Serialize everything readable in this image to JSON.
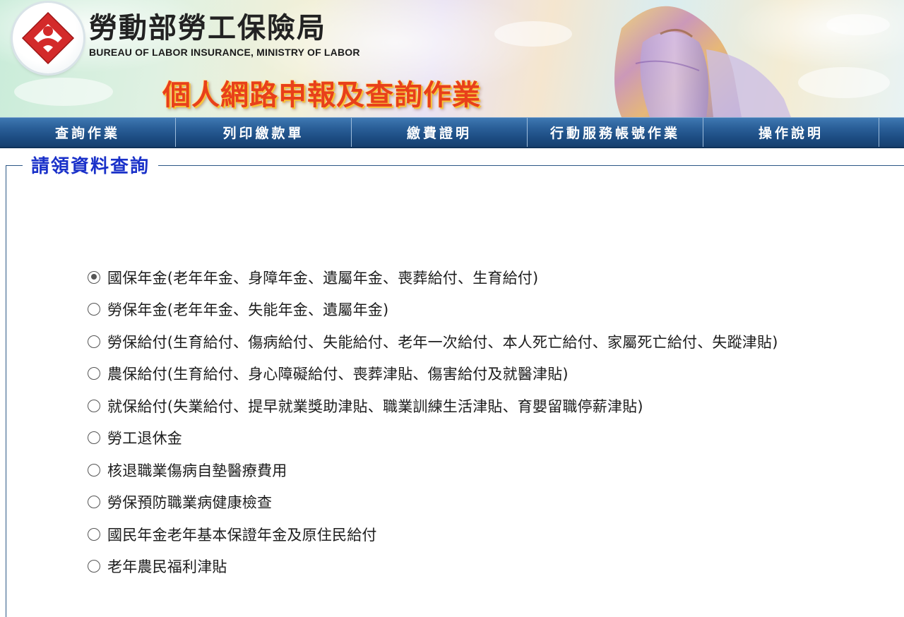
{
  "header": {
    "agency_name": "勞動部勞工保險局",
    "agency_name_en": "BUREAU OF LABOR INSURANCE, MINISTRY OF LABOR",
    "system_title": "個人網路申報及查詢作業",
    "logo_icon": "bli-logo-icon",
    "colors": {
      "system_title": "#e8401a",
      "agency_name": "#222222"
    }
  },
  "nav": {
    "items": [
      {
        "label": "查詢作業"
      },
      {
        "label": "列印繳款單"
      },
      {
        "label": "繳費證明"
      },
      {
        "label": "行動服務帳號作業"
      },
      {
        "label": "操作說明"
      }
    ],
    "colors": {
      "bar": "#1c4c82",
      "text": "#ffffff"
    }
  },
  "panel": {
    "legend": "請領資料查詢",
    "colors": {
      "legend": "#1a31c9",
      "border": "#2c5786"
    }
  },
  "options": [
    {
      "label": "國保年金(老年年金、身障年金、遺屬年金、喪葬給付、生育給付)",
      "checked": true
    },
    {
      "label": "勞保年金(老年年金、失能年金、遺屬年金)",
      "checked": false
    },
    {
      "label": "勞保給付(生育給付、傷病給付、失能給付、老年一次給付、本人死亡給付、家屬死亡給付、失蹤津貼)",
      "checked": false
    },
    {
      "label": "農保給付(生育給付、身心障礙給付、喪葬津貼、傷害給付及就醫津貼)",
      "checked": false
    },
    {
      "label": "就保給付(失業給付、提早就業獎助津貼、職業訓練生活津貼、育嬰留職停薪津貼)",
      "checked": false
    },
    {
      "label": "勞工退休金",
      "checked": false
    },
    {
      "label": "核退職業傷病自墊醫療費用",
      "checked": false
    },
    {
      "label": "勞保預防職業病健康檢查",
      "checked": false
    },
    {
      "label": "國民年金老年基本保證年金及原住民給付",
      "checked": false
    },
    {
      "label": "老年農民福利津貼",
      "checked": false
    }
  ]
}
